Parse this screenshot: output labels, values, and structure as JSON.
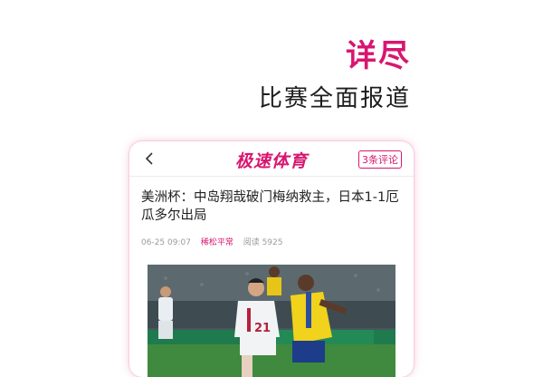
{
  "promo": {
    "title": "详尽",
    "subtitle": "比赛全面报道"
  },
  "app": {
    "back_icon": "chevron-left-icon",
    "logo_text": "极速体育",
    "comment_button": "3条评论"
  },
  "article": {
    "title": "美洲杯：中岛翔哉破门梅纳救主，日本1-1厄瓜多尔出局",
    "date": "06-25 09:07",
    "author": "稀松平常",
    "reads": "阅读 5925",
    "photo": {
      "jersey_number": "21"
    }
  },
  "colors": {
    "accent": "#d8166f"
  }
}
